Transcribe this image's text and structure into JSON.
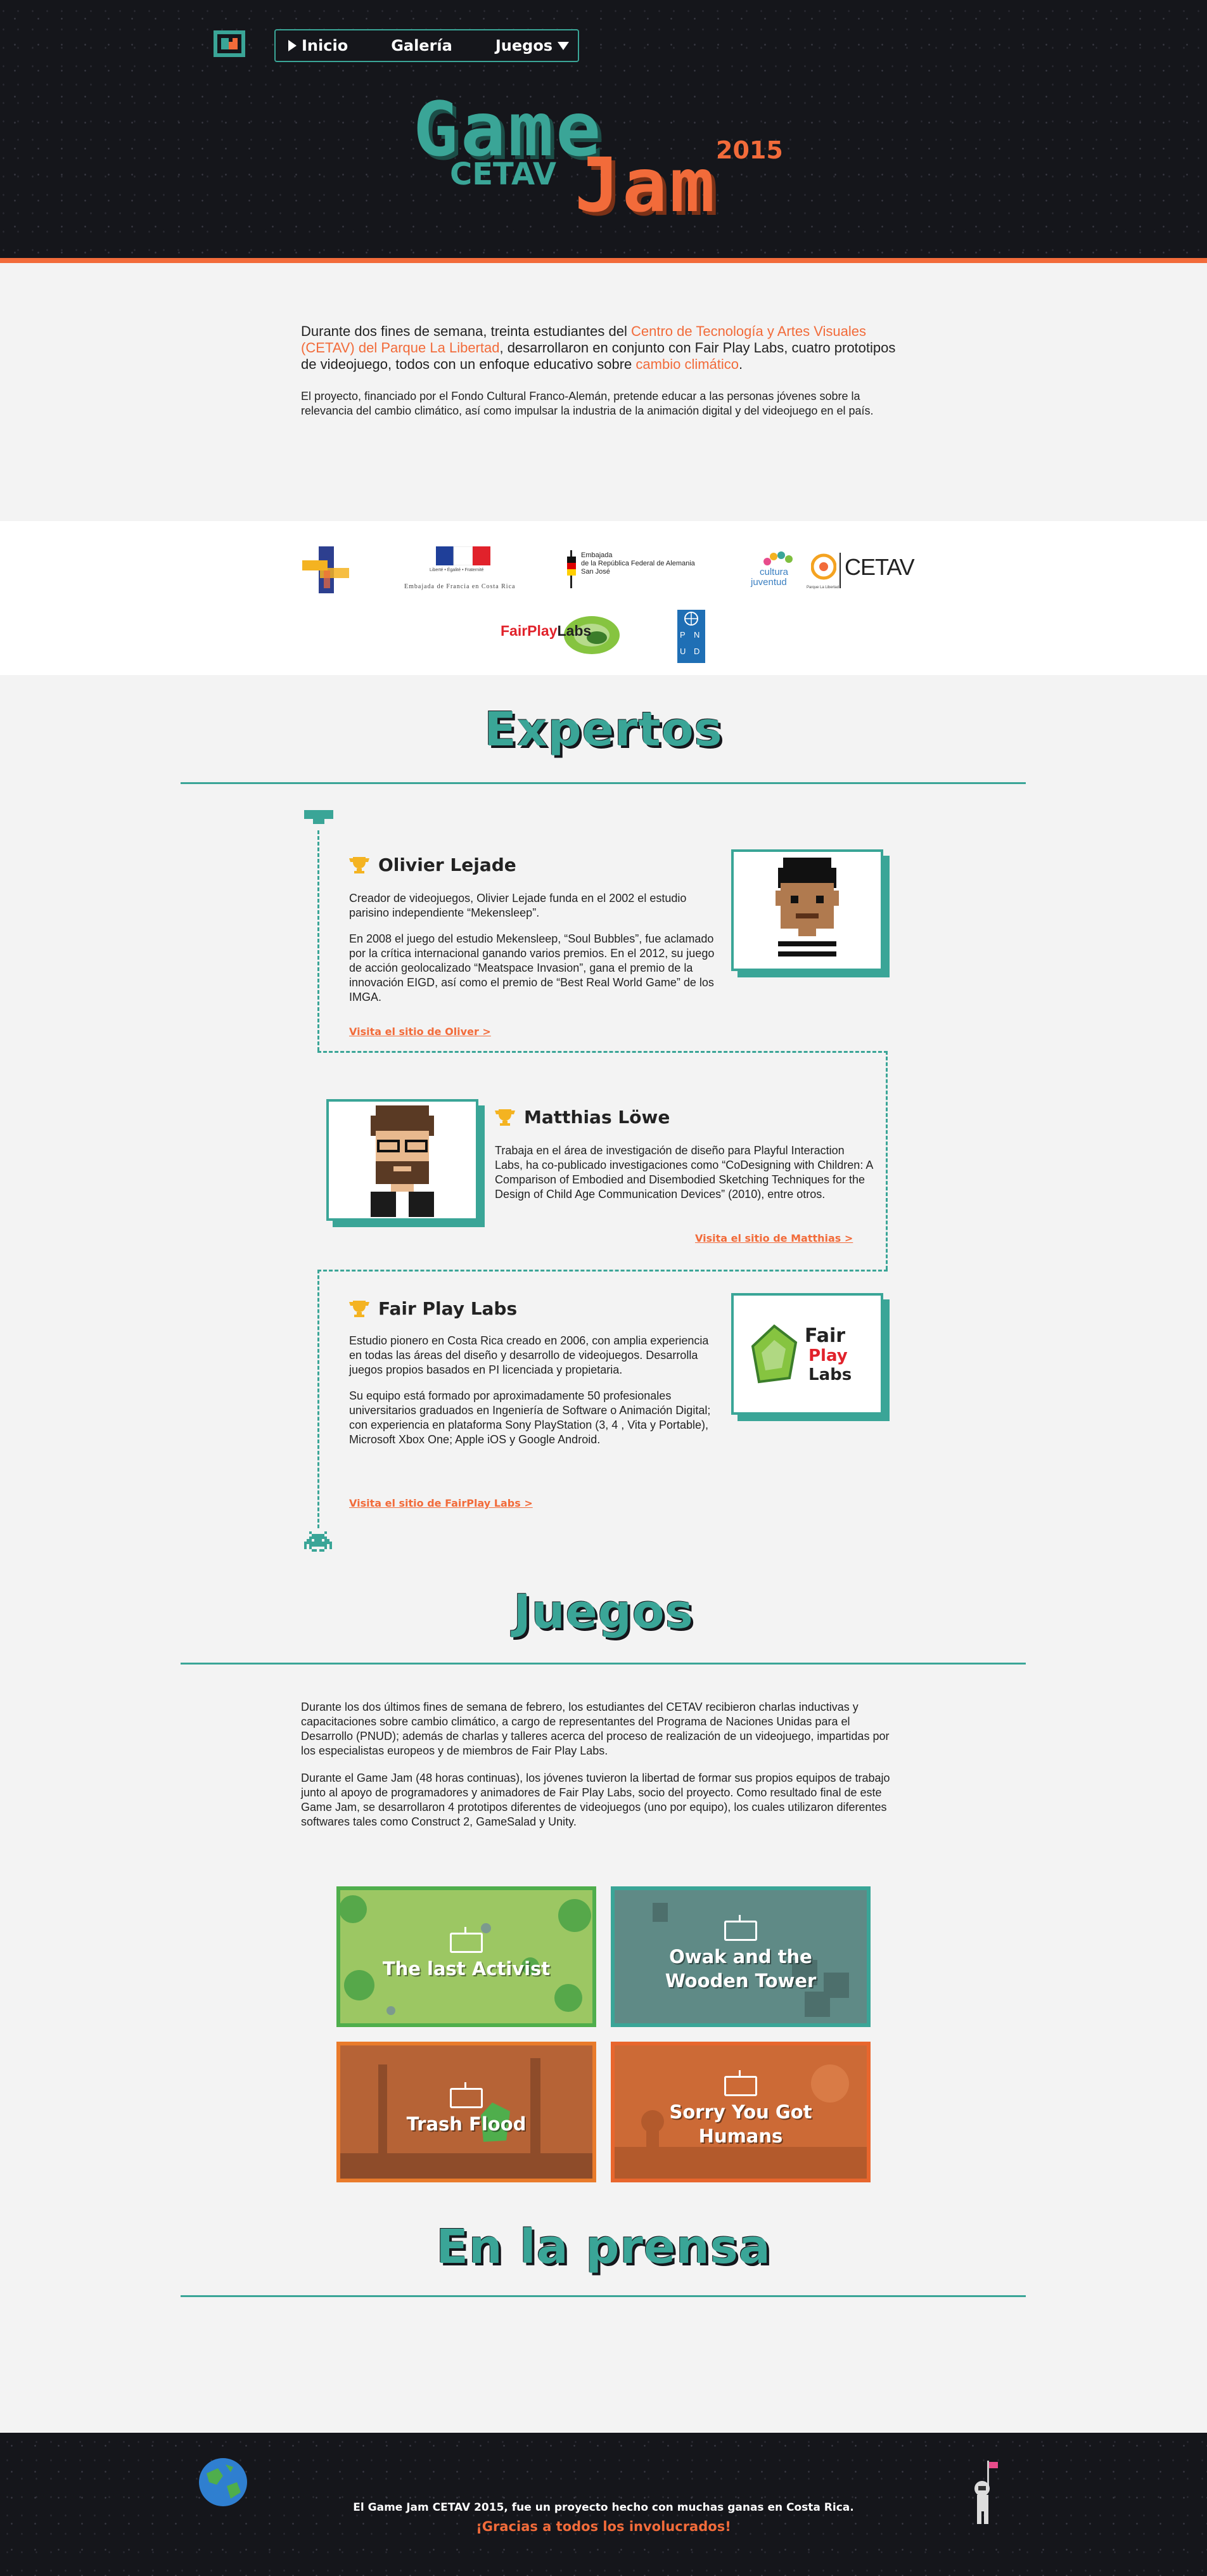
{
  "nav": {
    "items": [
      {
        "label": "Inicio"
      },
      {
        "label": "Galería"
      },
      {
        "label": "Juegos"
      }
    ]
  },
  "hero": {
    "logo_game": "Game",
    "logo_cetav": "CETAV",
    "logo_jam": "Jam",
    "logo_year": "2015"
  },
  "intro": {
    "p1_a": "Durante dos fines de semana, treinta estudiantes del ",
    "p1_link": "Centro de Tecnología y Artes Visuales (CETAV) del Parque La Libertad",
    "p1_b": ", desarrollaron en conjunto con Fair Play Labs, cuatro prototipos de videojuego, todos con un enfoque educativo sobre ",
    "p1_link2": "cambio climático",
    "p1_c": ".",
    "p2": "El proyecto, financiado por el Fondo Cultural Franco-Alemán, pretende educar a las personas jóvenes sobre la relevancia del cambio climático, así como impulsar la industria de la animación digital y del videojuego en el país."
  },
  "sponsors": {
    "france_caption": "Embajada de Francia en Costa Rica",
    "france_small": "Liberté • Égalité • Fraternité",
    "germany_line1": "Embajada",
    "germany_line2": "de la República Federal de Alemania",
    "germany_line3": "San José",
    "cultura_label": "cultura",
    "juventud_label": "juventud",
    "cetav_label": "CETAV",
    "parque_label": "Parque La Libertad",
    "fairplay_a": "FairPlay",
    "fairplay_b": "Labs",
    "pnud_letters": [
      "P",
      "N",
      "U",
      "D"
    ]
  },
  "experts": {
    "title": "Expertos",
    "items": [
      {
        "name": "Olivier Lejade",
        "paragraphs": [
          "Creador de videojuegos, Olivier Lejade funda en el 2002 el estudio parisino independiente “Mekensleep”.",
          "En 2008 el juego del estudio Mekensleep, “Soul Bubbles”, fue aclamado por la crítica internacional ganando varios premios. En el 2012, su juego de acción geolocalizado “Meatspace Invasion”, gana el premio de la innovación EIGD, así como el premio de “Best Real World Game” de los IMGA."
        ],
        "link": "Visita el sitio de Oliver >"
      },
      {
        "name": "Matthias Löwe",
        "paragraphs": [
          "Trabaja en el área de investigación de diseño para Playful Interaction Labs, ha co-publicado investigaciones como “CoDesigning with Children: A Comparison of Embodied and Disembodied Sketching Techniques for the Design of Child Age Communication Devices” (2010), entre otros."
        ],
        "link": "Visita el sitio de Matthias >"
      },
      {
        "name": "Fair Play Labs",
        "paragraphs": [
          "Estudio pionero en Costa Rica creado en 2006, con amplia experiencia en todas las áreas del diseño y desarrollo de videojuegos. Desarrolla juegos propios basados en PI licenciada y propietaria.",
          "Su equipo está formado por aproximadamente 50 profesionales universitarios graduados en Ingeniería de Software o Animación Digital; con experiencia en plataforma Sony PlayStation (3, 4 , Vita y Portable), Microsoft Xbox One; Apple iOS y Google Android."
        ],
        "link": "Visita el sitio de FairPlay Labs >",
        "logo_fair": "Fair",
        "logo_play": "Play",
        "logo_labs": "Labs"
      }
    ]
  },
  "games": {
    "title": "Juegos",
    "paragraphs": [
      "Durante los dos últimos fines de semana de febrero, los estudiantes del CETAV recibieron charlas inductivas y capacitaciones sobre cambio climático, a cargo de representantes del Programa de Naciones Unidas para el Desarrollo (PNUD); además de charlas y talleres acerca del proceso de realización de un videojuego, impartidas por los especialistas europeos y de miembros de Fair Play Labs.",
      "Durante el Game Jam (48 horas continuas), los jóvenes tuvieron la libertad de formar sus propios equipos de trabajo junto al apoyo de programadores y animadores de Fair Play Labs, socio del proyecto. Como resultado final de este Game Jam, se desarrollaron 4 prototipos diferentes de videojuegos (uno por equipo), los cuales utilizaron diferentes softwares tales como Construct 2, GameSalad y Unity."
    ],
    "cards": [
      {
        "line1": "The last Activist",
        "line2": ""
      },
      {
        "line1": "Owak and the",
        "line2": "Wooden Tower"
      },
      {
        "line1": "Trash Flood",
        "line2": ""
      },
      {
        "line1": "Sorry You Got",
        "line2": "Humans"
      }
    ]
  },
  "press": {
    "title": "En la prensa"
  },
  "footer": {
    "line1": "El Game Jam CETAV 2015, fue un proyecto hecho con muchas ganas en Costa Rica.",
    "line2": "¡Gracias a todos los involucrados!"
  },
  "colors": {
    "teal": "#3aa597",
    "orange": "#f26b3a",
    "dark": "#15161b",
    "card_green": "#4fae4c",
    "card_teal": "#3e8e85",
    "card_orange": "#e97b2b",
    "card_orange2": "#e8662d"
  }
}
